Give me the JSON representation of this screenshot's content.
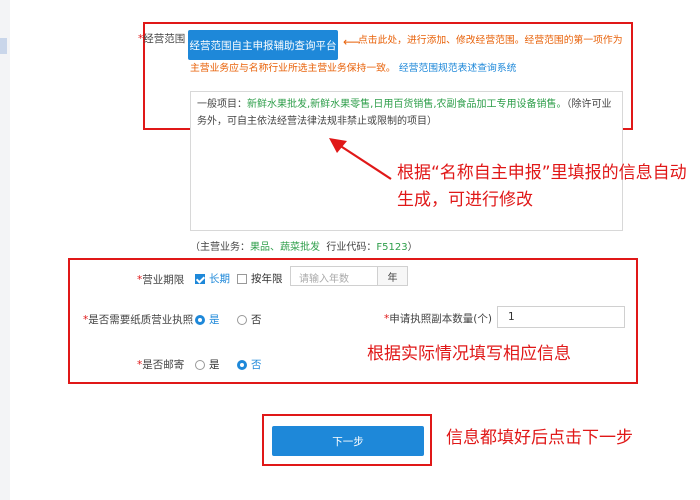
{
  "scope": {
    "label": "经营范围",
    "button_label": "经营范围自主申报辅助查询平台",
    "hint_line1": "点击此处，进行添加、修改经营范围。经营范围的第一项作为",
    "hint_line2": "主营业务应与名称行业所选主营业务保持一致。",
    "hint_link": "经营范围规范表述查询系统",
    "textarea_prefix": "一般项目：",
    "textarea_items": "新鲜水果批发,新鲜水果零售,日用百货销售,农副食品加工专用设备销售。",
    "textarea_suffix": "（除许可业务外，可自主依法经营法律法规非禁止或限制的项目）"
  },
  "annotations": {
    "auto_generate": "根据“名称自主申报”里填报的信息自动生成，可进行修改",
    "fill_info": "根据实际情况填写相应信息",
    "next_hint": "信息都填好后点击下一步"
  },
  "main_business": {
    "prefix": "（主营业务：",
    "value": "果品、蔬菜批发",
    "industry_label": "行业代码：",
    "industry_code": "F5123",
    "suffix": "）"
  },
  "form": {
    "term": {
      "label": "营业期限",
      "opt_longterm": "长期",
      "opt_longterm_checked": true,
      "opt_byyear": "按年限",
      "opt_byyear_checked": false,
      "years_placeholder": "请输入年数",
      "year_unit": "年"
    },
    "paper_license": {
      "label": "是否需要纸质营业执照",
      "yes": "是",
      "no": "否",
      "selected": "yes"
    },
    "copies": {
      "label": "申请执照副本数量(个)",
      "value": "1"
    },
    "mail": {
      "label": "是否邮寄",
      "yes": "是",
      "no": "否",
      "selected": "no"
    },
    "required_mark": "*"
  },
  "footer": {
    "next_button": "下一步"
  },
  "colors": {
    "primary": "#1e88d9",
    "annotation_red": "#e01818",
    "hint_orange": "#e8620a",
    "green": "#2e9e4a"
  }
}
